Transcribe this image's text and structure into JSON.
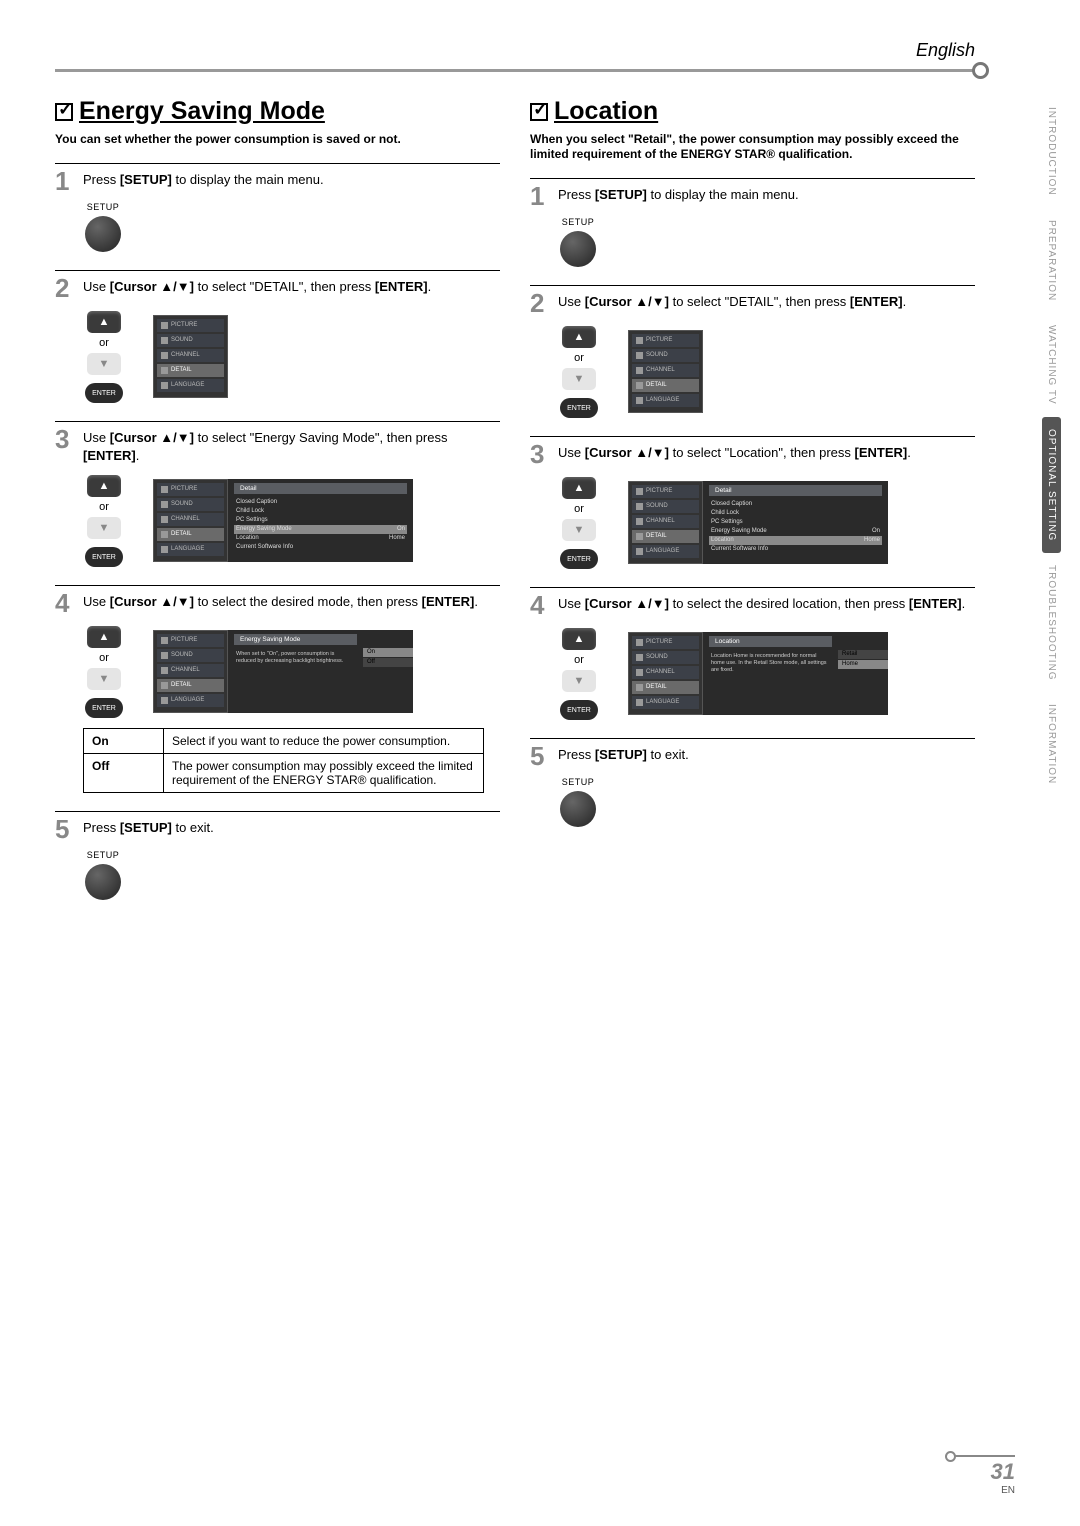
{
  "lang": "English",
  "side_tabs": [
    "INTRODUCTION",
    "PREPARATION",
    "WATCHING TV",
    "OPTIONAL SETTING",
    "TROUBLESHOOTING",
    "INFORMATION"
  ],
  "side_tab_active": 3,
  "page_number": "31",
  "page_lang_code": "EN",
  "menu_items": [
    "PICTURE",
    "SOUND",
    "CHANNEL",
    "DETAIL",
    "LANGUAGE"
  ],
  "detail_items": [
    {
      "label": "Closed Caption",
      "val": ""
    },
    {
      "label": "Child Lock",
      "val": ""
    },
    {
      "label": "PC Settings",
      "val": ""
    },
    {
      "label": "Energy Saving Mode",
      "val": "On"
    },
    {
      "label": "Location",
      "val": "Home"
    },
    {
      "label": "Current Software Info",
      "val": ""
    }
  ],
  "left": {
    "title": "Energy Saving Mode",
    "intro": "You can set whether the power consumption is saved or not.",
    "steps": {
      "s1": {
        "pre": "Press ",
        "b": "[SETUP]",
        "post": " to display the main menu."
      },
      "s2": {
        "pre": "Use ",
        "b1": "[Cursor ▲/▼]",
        "mid": " to select \"DETAIL\", then press ",
        "b2": "[ENTER]",
        "post": "."
      },
      "s3": {
        "pre": "Use ",
        "b1": "[Cursor ▲/▼]",
        "mid": " to select \"Energy Saving Mode\", then press ",
        "b2": "[ENTER]",
        "post": "."
      },
      "s4": {
        "pre": "Use ",
        "b1": "[Cursor ▲/▼]",
        "mid": " to select the desired mode, then press ",
        "b2": "[ENTER]",
        "post": "."
      },
      "s5": {
        "pre": "Press ",
        "b": "[SETUP]",
        "post": " to exit."
      }
    },
    "esm_header": "Energy Saving Mode",
    "esm_desc": "When set to \"On\", power consumption is reduced by decreasing backlight brightness.",
    "esm_opts": [
      "On",
      "Off"
    ],
    "table": [
      {
        "k": "On",
        "v": "Select if you want to reduce the power consumption."
      },
      {
        "k": "Off",
        "v": "The power consumption may possibly exceed the limited requirement of the ENERGY STAR® qualification."
      }
    ]
  },
  "right": {
    "title": "Location",
    "intro": "When you select \"Retail\", the power consumption may possibly exceed the limited requirement of the ENERGY STAR® qualification.",
    "steps": {
      "s1": {
        "pre": "Press ",
        "b": "[SETUP]",
        "post": " to display the main menu."
      },
      "s2": {
        "pre": "Use ",
        "b1": "[Cursor ▲/▼]",
        "mid": " to select \"DETAIL\", then press ",
        "b2": "[ENTER]",
        "post": "."
      },
      "s3": {
        "pre": "Use ",
        "b1": "[Cursor ▲/▼]",
        "mid": " to select \"Location\", then press ",
        "b2": "[ENTER]",
        "post": "."
      },
      "s4": {
        "pre": "Use ",
        "b1": "[Cursor ▲/▼]",
        "mid": " to select the desired location, then press ",
        "b2": "[ENTER]",
        "post": "."
      },
      "s5": {
        "pre": "Press ",
        "b": "[SETUP]",
        "post": " to exit."
      }
    },
    "loc_header": "Location",
    "loc_desc": "Location Home is recommended for normal home use. In the Retail Store mode, all settings are fixed.",
    "loc_opts": [
      "Retail",
      "Home"
    ]
  },
  "labels": {
    "setup": "SETUP",
    "enter": "ENTER",
    "or": "or",
    "detail": "Detail"
  }
}
